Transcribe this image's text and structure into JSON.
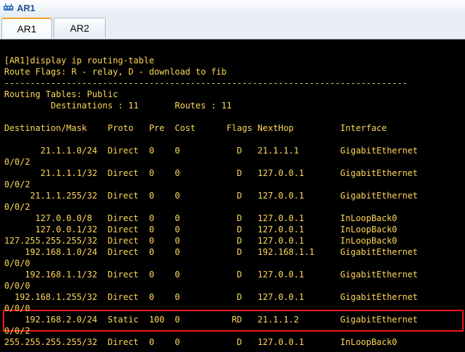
{
  "window": {
    "title": "AR1"
  },
  "tabs": [
    {
      "label": "AR1",
      "active": true
    },
    {
      "label": "AR2",
      "active": false
    }
  ],
  "colors": {
    "terminal_bg": "#000000",
    "terminal_text": "#ffd75a",
    "highlight_border": "#ff1a1a",
    "active_tab_accent": "#f0a020"
  },
  "terminal": {
    "lines": [
      "",
      "[AR1]display ip routing-table",
      "Route Flags: R - relay, D - download to fib",
      "------------------------------------------------------------------------------",
      "Routing Tables: Public",
      "         Destinations : 11       Routes : 11",
      "",
      "Destination/Mask    Proto   Pre  Cost      Flags NextHop         Interface",
      "",
      "       21.1.1.0/24  Direct  0    0           D   21.1.1.1        GigabitEthernet",
      "0/0/2",
      "       21.1.1.1/32  Direct  0    0           D   127.0.0.1       GigabitEthernet",
      "0/0/2",
      "     21.1.1.255/32  Direct  0    0           D   127.0.0.1       GigabitEthernet",
      "0/0/2",
      "      127.0.0.0/8   Direct  0    0           D   127.0.0.1       InLoopBack0",
      "      127.0.0.1/32  Direct  0    0           D   127.0.0.1       InLoopBack0",
      "127.255.255.255/32  Direct  0    0           D   127.0.0.1       InLoopBack0",
      "    192.168.1.0/24  Direct  0    0           D   192.168.1.1     GigabitEthernet",
      "0/0/0",
      "    192.168.1.1/32  Direct  0    0           D   127.0.0.1       GigabitEthernet",
      "0/0/0",
      "  192.168.1.255/32  Direct  0    0           D   127.0.0.1       GigabitEthernet",
      "0/0/0",
      "    192.168.2.0/24  Static  100  0          RD   21.1.1.2        GigabitEthernet",
      "0/0/2",
      "255.255.255.255/32  Direct  0    0           D   127.0.0.1       InLoopBack0"
    ]
  }
}
